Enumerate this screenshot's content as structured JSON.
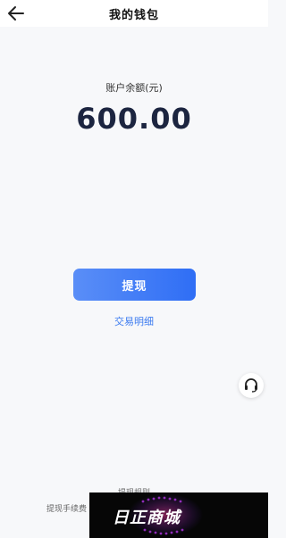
{
  "header": {
    "title": "我的钱包"
  },
  "wallet": {
    "balance_label": "账户余额(元)",
    "balance_value": "600.00"
  },
  "actions": {
    "withdraw_label": "提现",
    "transactions_label": "交易明细"
  },
  "rules": {
    "title": "提现规则",
    "text": "提现手续费"
  },
  "watermark": {
    "text": "日正商城"
  },
  "colors": {
    "accent": "#2f6ef5",
    "link": "#3c7bf0",
    "background": "#f7f8fa"
  },
  "icons": {
    "back": "arrow-left-icon",
    "support": "headset-icon"
  }
}
